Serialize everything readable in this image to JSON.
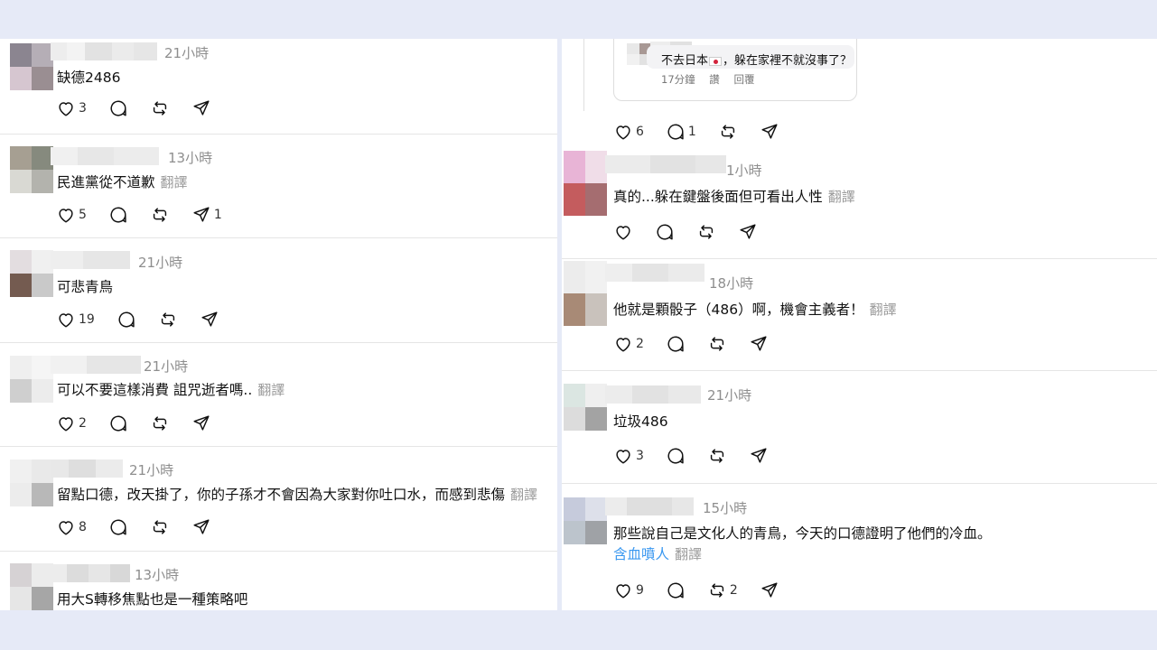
{
  "left_posts": [
    {
      "time": "21小時",
      "text": "缺德2486",
      "translate": "",
      "likes": "3",
      "replies": "",
      "reposts": "",
      "shares": ""
    },
    {
      "time": "13小時",
      "text": "民進黨從不道歉",
      "translate": "翻譯",
      "likes": "5",
      "replies": "",
      "reposts": "",
      "shares": "1"
    },
    {
      "time": "21小時",
      "text": "可悲青鳥",
      "translate": "",
      "likes": "19",
      "replies": "",
      "reposts": "",
      "shares": ""
    },
    {
      "time": "21小時",
      "text": "可以不要這樣消費 詛咒逝者嗎..",
      "translate": "翻譯",
      "likes": "2",
      "replies": "",
      "reposts": "",
      "shares": ""
    },
    {
      "time": "21小時",
      "text": "留點口德，改天掛了，你的子孫才不會因為大家對你吐口水，而感到悲傷",
      "translate": "翻譯",
      "likes": "8",
      "replies": "",
      "reposts": "",
      "shares": ""
    },
    {
      "time": "13小時",
      "text": "用大S轉移焦點也是一種策略吧",
      "translate": "",
      "likes": "",
      "replies": "",
      "reposts": "",
      "shares": ""
    }
  ],
  "right_quote": {
    "text_before": "不去日本",
    "text_after": "，躲在家裡不就沒事了？",
    "time": "17分鐘",
    "like": "讚",
    "reply": "回覆"
  },
  "right_top_actions": {
    "likes": "6",
    "replies": "1",
    "reposts": "",
    "shares": ""
  },
  "right_posts": [
    {
      "time": "1小時",
      "text": "真的...躲在鍵盤後面但可看出人性",
      "translate": "翻譯",
      "likes": "",
      "replies": "",
      "reposts": "",
      "shares": ""
    },
    {
      "time": "18小時",
      "text": "他就是顆骰子（486）啊，機會主義者！",
      "translate": "翻譯",
      "likes": "2",
      "replies": "",
      "reposts": "",
      "shares": ""
    },
    {
      "time": "21小時",
      "text": "垃圾486",
      "translate": "",
      "likes": "3",
      "replies": "",
      "reposts": "",
      "shares": ""
    },
    {
      "time": "15小時",
      "text": "那些說自己是文化人的青鳥，今天的口德證明了他們的冷血。",
      "link": "含血噴人",
      "translate": "翻譯",
      "likes": "9",
      "replies": "",
      "reposts": "2",
      "shares": ""
    }
  ],
  "icons": {
    "like": "heart-icon",
    "reply": "comment-icon",
    "repost": "repost-icon",
    "share": "send-icon",
    "flag": "japan-flag-icon"
  },
  "colors": {
    "link": "#3897f0",
    "muted": "#8e8e8e",
    "divider": "#e5e5e5",
    "background": "#e6eaf7"
  }
}
